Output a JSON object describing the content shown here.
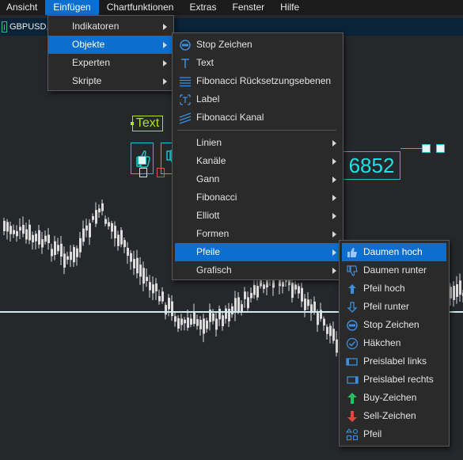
{
  "menubar": {
    "items": [
      "Ansicht",
      "Einfügen",
      "Chartfunktionen",
      "Extras",
      "Fenster",
      "Hilfe"
    ],
    "active_index": 1
  },
  "chart": {
    "symbol": "GBPUSD,",
    "text_object": "Text",
    "price_label": "6852",
    "colors": {
      "background": "#25272b",
      "accent": "#17c6c6",
      "text_object": "#a8e81e",
      "candle": "#dcdcdc"
    }
  },
  "menu_einfuegen": {
    "items": [
      {
        "label": "Indikatoren",
        "submenu": true
      },
      {
        "label": "Objekte",
        "submenu": true,
        "highlighted": true
      },
      {
        "label": "Experten",
        "submenu": true
      },
      {
        "label": "Skripte",
        "submenu": true
      }
    ]
  },
  "menu_objekte": {
    "top_items": [
      {
        "label": "Stop Zeichen",
        "icon": "stop-sign-icon"
      },
      {
        "label": "Text",
        "icon": "text-icon"
      },
      {
        "label": "Fibonacci Rücksetzungsebenen",
        "icon": "fibonacci-retracement-icon"
      },
      {
        "label": "Label",
        "icon": "label-icon"
      },
      {
        "label": "Fibonacci Kanal",
        "icon": "fibonacci-channel-icon"
      }
    ],
    "sub_items": [
      {
        "label": "Linien"
      },
      {
        "label": "Kanäle"
      },
      {
        "label": "Gann"
      },
      {
        "label": "Fibonacci"
      },
      {
        "label": "Elliott"
      },
      {
        "label": "Formen"
      },
      {
        "label": "Pfeile",
        "highlighted": true
      },
      {
        "label": "Grafisch"
      }
    ]
  },
  "menu_pfeile": {
    "items": [
      {
        "label": "Daumen hoch",
        "icon": "thumbs-up-icon",
        "highlighted": true
      },
      {
        "label": "Daumen runter",
        "icon": "thumbs-down-icon"
      },
      {
        "label": "Pfeil hoch",
        "icon": "arrow-up-icon"
      },
      {
        "label": "Pfeil runter",
        "icon": "arrow-down-icon"
      },
      {
        "label": "Stop Zeichen",
        "icon": "stop-sign-icon"
      },
      {
        "label": "Häkchen",
        "icon": "checkmark-icon"
      },
      {
        "label": "Preislabel links",
        "icon": "price-label-left-icon"
      },
      {
        "label": "Preislabel rechts",
        "icon": "price-label-right-icon"
      },
      {
        "label": "Buy-Zeichen",
        "icon": "buy-sign-icon"
      },
      {
        "label": "Sell-Zeichen",
        "icon": "sell-sign-icon"
      },
      {
        "label": "Pfeil",
        "icon": "arrow-shapes-icon"
      }
    ]
  }
}
